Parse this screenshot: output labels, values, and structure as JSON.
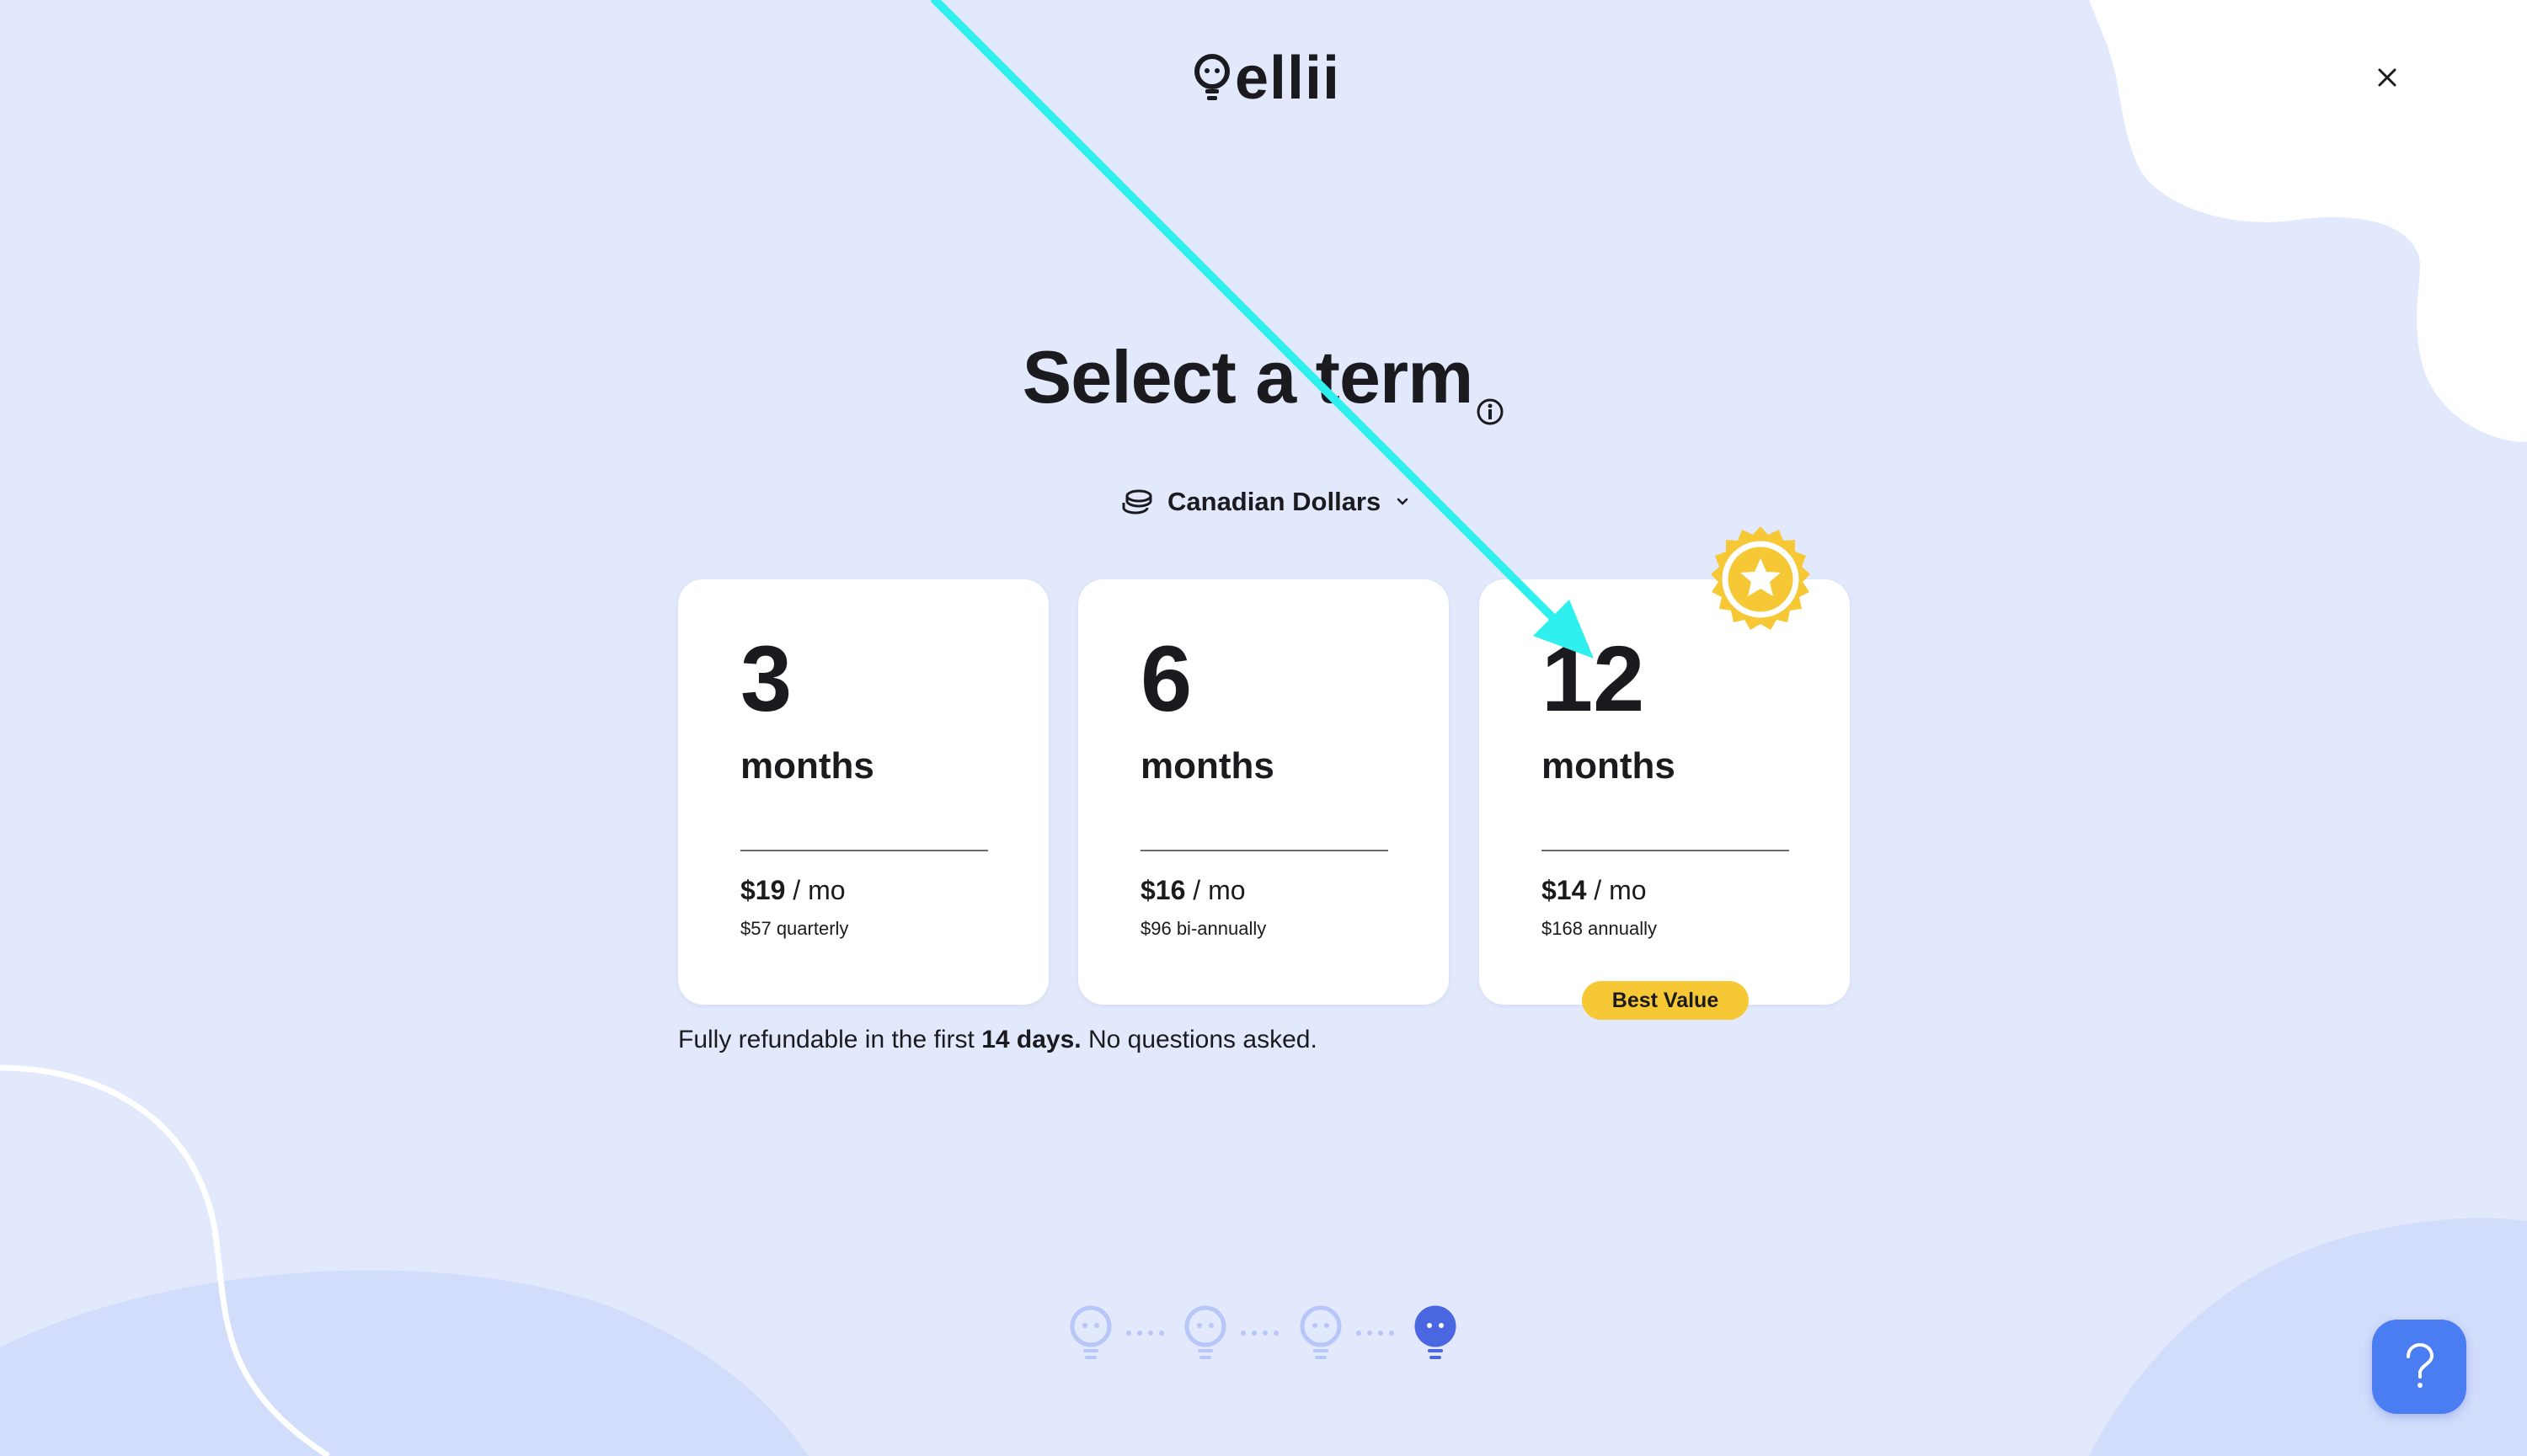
{
  "header": {
    "logo_text": "ellii",
    "close_icon": "close-icon"
  },
  "page": {
    "title": "Select a term",
    "info_icon": "info-icon"
  },
  "currency_selector": {
    "icon": "coins-icon",
    "label": "Canadian Dollars",
    "chevron": "chevron-down-icon"
  },
  "plans": [
    {
      "number": "3",
      "unit": "months",
      "price": "$19",
      "per": " / mo",
      "total": "$57 quarterly"
    },
    {
      "number": "6",
      "unit": "months",
      "price": "$16",
      "per": " / mo",
      "total": "$96 bi-annually"
    },
    {
      "number": "12",
      "unit": "months",
      "price": "$14",
      "per": " / mo",
      "total": "$168 annually",
      "badge": "Best Value",
      "seal_icon": "star-seal-icon"
    }
  ],
  "refund": {
    "before": "Fully refundable in the first ",
    "bold": "14 days.",
    "after": " No questions asked."
  },
  "progress": {
    "steps": 4,
    "current_step": 4,
    "step_icon": "lightbulb-icon"
  },
  "help_button": {
    "icon": "question-mark-icon"
  },
  "colors": {
    "background": "#e3e9fc",
    "accent_yellow": "#f7c836",
    "help_blue": "#4a7df1",
    "arrow_cyan": "#2ff0ef"
  }
}
